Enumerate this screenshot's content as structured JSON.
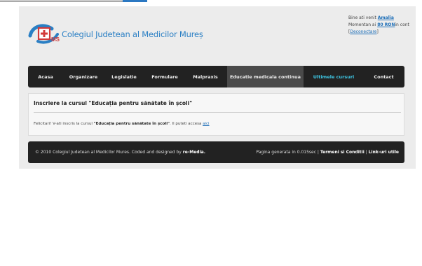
{
  "site": {
    "title": "Colegiul Judetean al Medicilor Mureș",
    "logo_text": "MS"
  },
  "user": {
    "greeting": "Bine ati venit",
    "name": "Amalia",
    "balance_prefix": "Momentan ai",
    "balance": "80 RON",
    "balance_suffix": "in cont",
    "logout_label": "Deconectare"
  },
  "nav": {
    "items": [
      {
        "label": "Acasa"
      },
      {
        "label": "Organizare"
      },
      {
        "label": "Legislatie"
      },
      {
        "label": "Formulare"
      },
      {
        "label": "Malpraxis"
      },
      {
        "label": "Educatie medicala continua"
      },
      {
        "label": "Ultimele cursuri"
      },
      {
        "label": "Contact"
      }
    ],
    "active_index": 5,
    "accent_index": 6
  },
  "content": {
    "heading": "Inscriere la cursul \"Educația pentru sănătate în școli\"",
    "message_prefix": "Felicitari! V-ati inscris la cursul",
    "course_name": "\"Educația pentru sănătate în școli\"",
    "message_middle": ". Il puteti accesa",
    "link_label": "aici"
  },
  "footer": {
    "copyright": "© 2010 Colegiul Judetean al Medicilor Mures. Coded and designed by",
    "designer": "re-Media.",
    "generated": "Pagina generata in 0.015sec |",
    "terms_label": "Termeni si Conditii",
    "separator": "|",
    "links_label": "Link-uri utile"
  },
  "colors": {
    "accent": "#2a7fc4",
    "nav_bg": "#222222",
    "nav_active": "#4a4a4a",
    "nav_accent": "#3ec8e6"
  }
}
